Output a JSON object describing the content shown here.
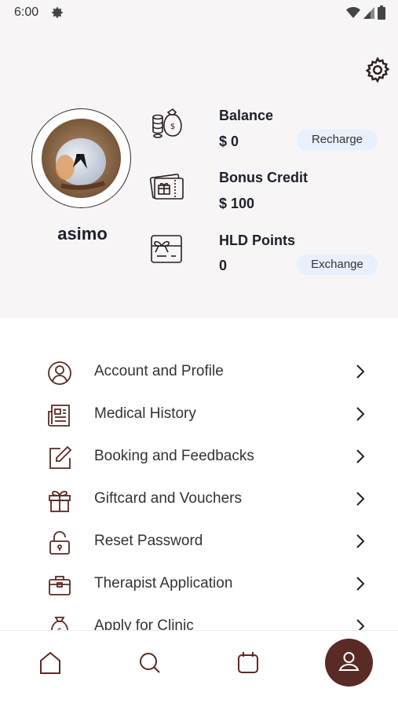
{
  "status_bar": {
    "time": "6:00",
    "icons": [
      "settings-icon",
      "wifi-icon",
      "signal-icon",
      "battery-icon"
    ]
  },
  "header": {
    "settings_icon": "gear-icon",
    "username": "asimo",
    "wallet": {
      "balance_label": "Balance",
      "balance_value": "$ 0",
      "recharge_label": "Recharge",
      "bonus_label": "Bonus Credit",
      "bonus_value": "$ 100",
      "points_label": "HLD Points",
      "points_value": "0",
      "exchange_label": "Exchange"
    }
  },
  "menu": {
    "items": [
      {
        "label": "Account and Profile",
        "icon": "user-circle-icon"
      },
      {
        "label": "Medical History",
        "icon": "newspaper-icon"
      },
      {
        "label": "Booking and Feedbacks",
        "icon": "edit-icon"
      },
      {
        "label": "Giftcard and Vouchers",
        "icon": "gift-icon"
      },
      {
        "label": "Reset Password",
        "icon": "unlock-icon"
      },
      {
        "label": "Therapist Application",
        "icon": "briefcase-icon"
      },
      {
        "label": "Apply for Clinic",
        "icon": "money-bag-icon"
      }
    ]
  },
  "bottom_nav": {
    "items": [
      "home-icon",
      "search-icon",
      "calendar-icon",
      "profile-icon"
    ],
    "active": "profile-icon"
  },
  "colors": {
    "brand": "#5a2a24",
    "header_bg": "#f7f5f5",
    "pill_bg": "#e7f0fb",
    "icon": "#5a2a24"
  }
}
